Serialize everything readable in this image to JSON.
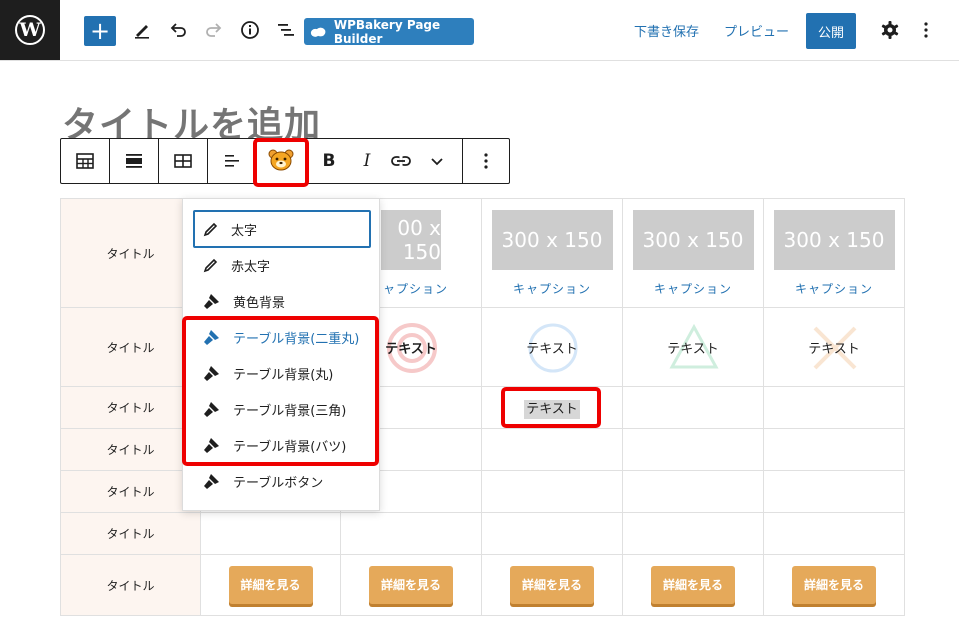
{
  "topbar": {
    "wpb_label": "WPBakery Page Builder",
    "save_draft": "下書き保存",
    "preview": "プレビュー",
    "publish": "公開",
    "icons": [
      "wordpress-logo-icon",
      "plus-icon",
      "pencil-icon",
      "undo-icon",
      "redo-icon",
      "info-icon",
      "list-view-icon",
      "wpbakery-cloud-icon",
      "gear-icon",
      "more-vertical-icon"
    ]
  },
  "post_title_placeholder": "タイトルを追加",
  "block_toolbar": {
    "icons": [
      "table-icon",
      "align-full-icon",
      "table-edit-icon",
      "align-left-icon",
      "bear-format-icon",
      "bold-icon",
      "italic-icon",
      "link-icon",
      "chevron-down-icon",
      "more-vertical-icon"
    ],
    "bold": "B",
    "italic": "I"
  },
  "dropdown": {
    "items": [
      {
        "label": "太字",
        "icon": "pencil-icon"
      },
      {
        "label": "赤太字",
        "icon": "pencil-icon"
      },
      {
        "label": "黄色背景",
        "icon": "marker-icon"
      },
      {
        "label": "テーブル背景(二重丸)",
        "icon": "marker-icon"
      },
      {
        "label": "テーブル背景(丸)",
        "icon": "marker-icon"
      },
      {
        "label": "テーブル背景(三角)",
        "icon": "marker-icon"
      },
      {
        "label": "テーブル背景(バツ)",
        "icon": "marker-icon"
      },
      {
        "label": "テーブルボタン",
        "icon": "marker-icon"
      }
    ]
  },
  "table": {
    "row_header": "タイトル",
    "placeholder": "300 x 150",
    "placeholder_partial": "00 x 150",
    "caption": "キャプション",
    "caption_partial": "ャプション",
    "text": "テキスト",
    "detail_button": "詳細を見る"
  },
  "colors": {
    "accent": "#2271b1",
    "highlight": "#e00000",
    "button": "#e5a95a",
    "header_bg": "#fdf5f0"
  }
}
